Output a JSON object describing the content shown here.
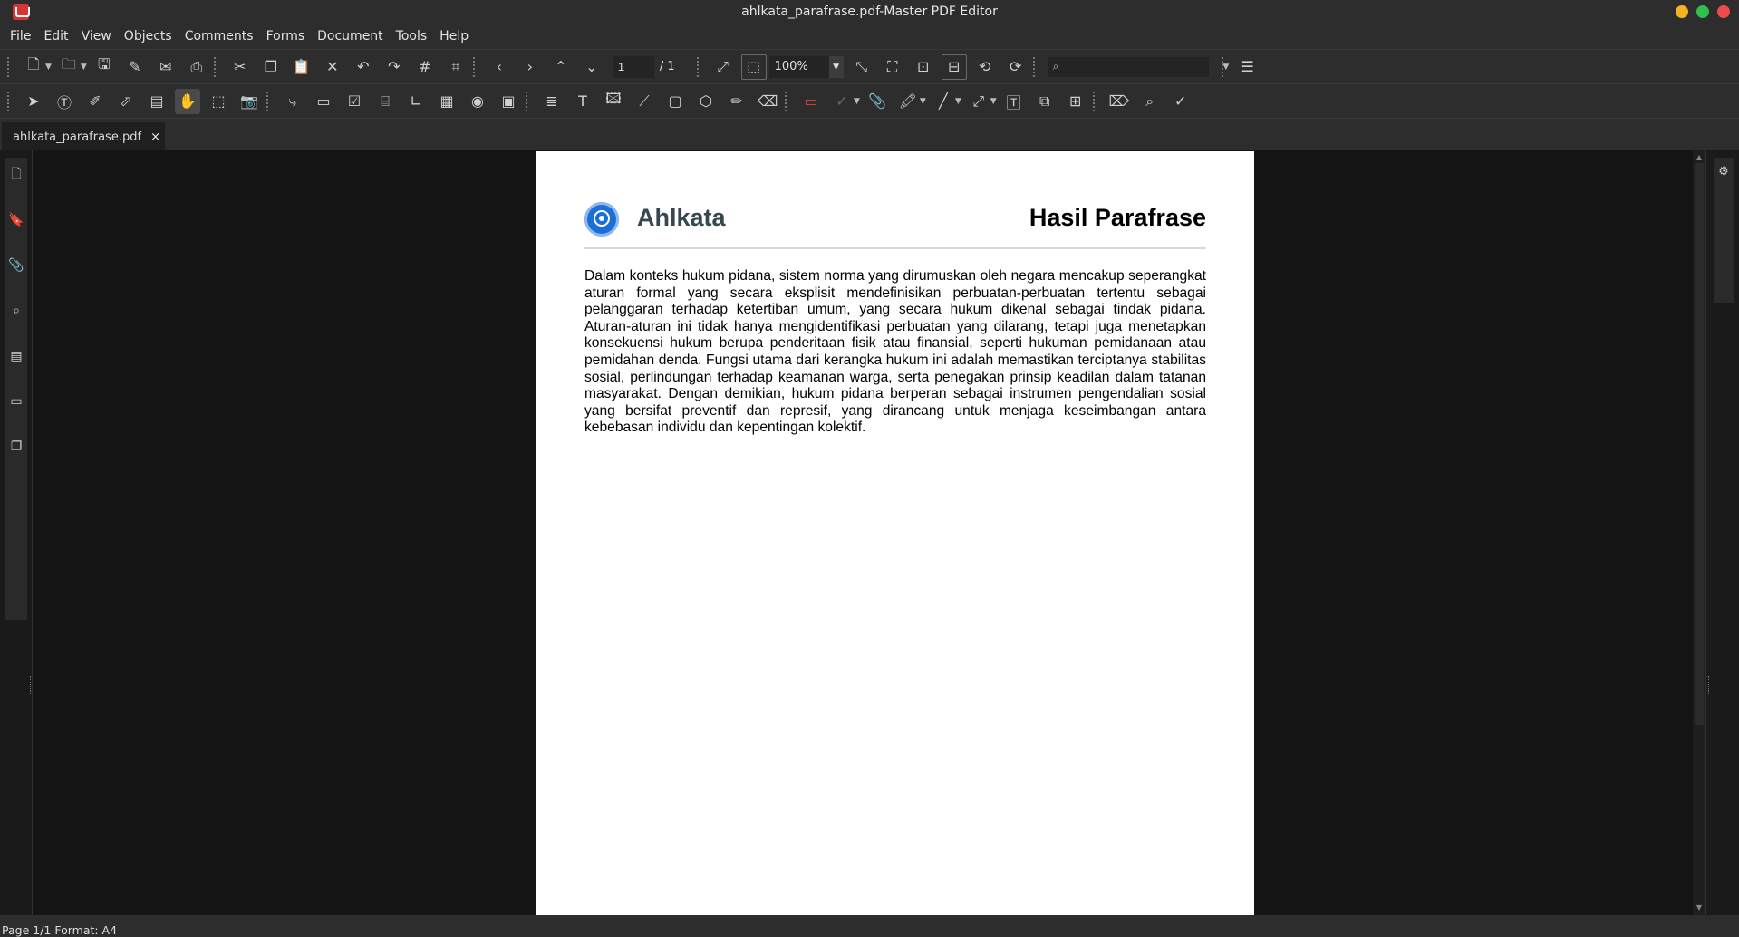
{
  "window": {
    "title": "ahlkata_parafrase.pdf-Master PDF Editor",
    "controls": [
      {
        "name": "minimize",
        "color": "#f5b324"
      },
      {
        "name": "maximize",
        "color": "#2fbf4a"
      },
      {
        "name": "close",
        "color": "#ef4b4b"
      }
    ]
  },
  "menu": [
    "File",
    "Edit",
    "View",
    "Objects",
    "Comments",
    "Forms",
    "Document",
    "Tools",
    "Help"
  ],
  "toolbar": {
    "page_current": "1",
    "page_total": "/ 1",
    "zoom": "100%",
    "search_value": ""
  },
  "tab": {
    "label": "ahlkata_parafrase.pdf",
    "close": "×"
  },
  "document": {
    "brand": "Ahlkata",
    "title": "Hasil Parafrase",
    "paragraph": "Dalam konteks hukum pidana, sistem norma yang dirumuskan oleh negara mencakup seperangkat aturan formal yang secara eksplisit mendefinisikan perbuatan-perbuatan tertentu sebagai pelanggaran terhadap ketertiban umum, yang secara hukum dikenal sebagai tindak pidana. Aturan-aturan ini tidak hanya mengidentifikasi perbuatan yang dilarang, tetapi juga menetapkan konsekuensi hukum berupa penderitaan fisik atau finansial, seperti hukuman pemidanaan atau pemidahan denda. Fungsi utama dari kerangka hukum ini adalah memastikan terciptanya stabilitas sosial, perlindungan terhadap keamanan warga, serta penegakan prinsip keadilan dalam tatanan masyarakat. Dengan demikian, hukum pidana berperan sebagai instrumen pengendalian sosial yang bersifat preventif dan represif, yang dirancang untuk menjaga keseimbangan antara kebebasan individu dan kepentingan kolektif."
  },
  "status": "Page 1/1 Format: A4",
  "colors": {
    "chrome": "#2d2d2d",
    "canvas": "#141414",
    "brand_text": "#37474f",
    "logo": "#1d6fd8"
  }
}
